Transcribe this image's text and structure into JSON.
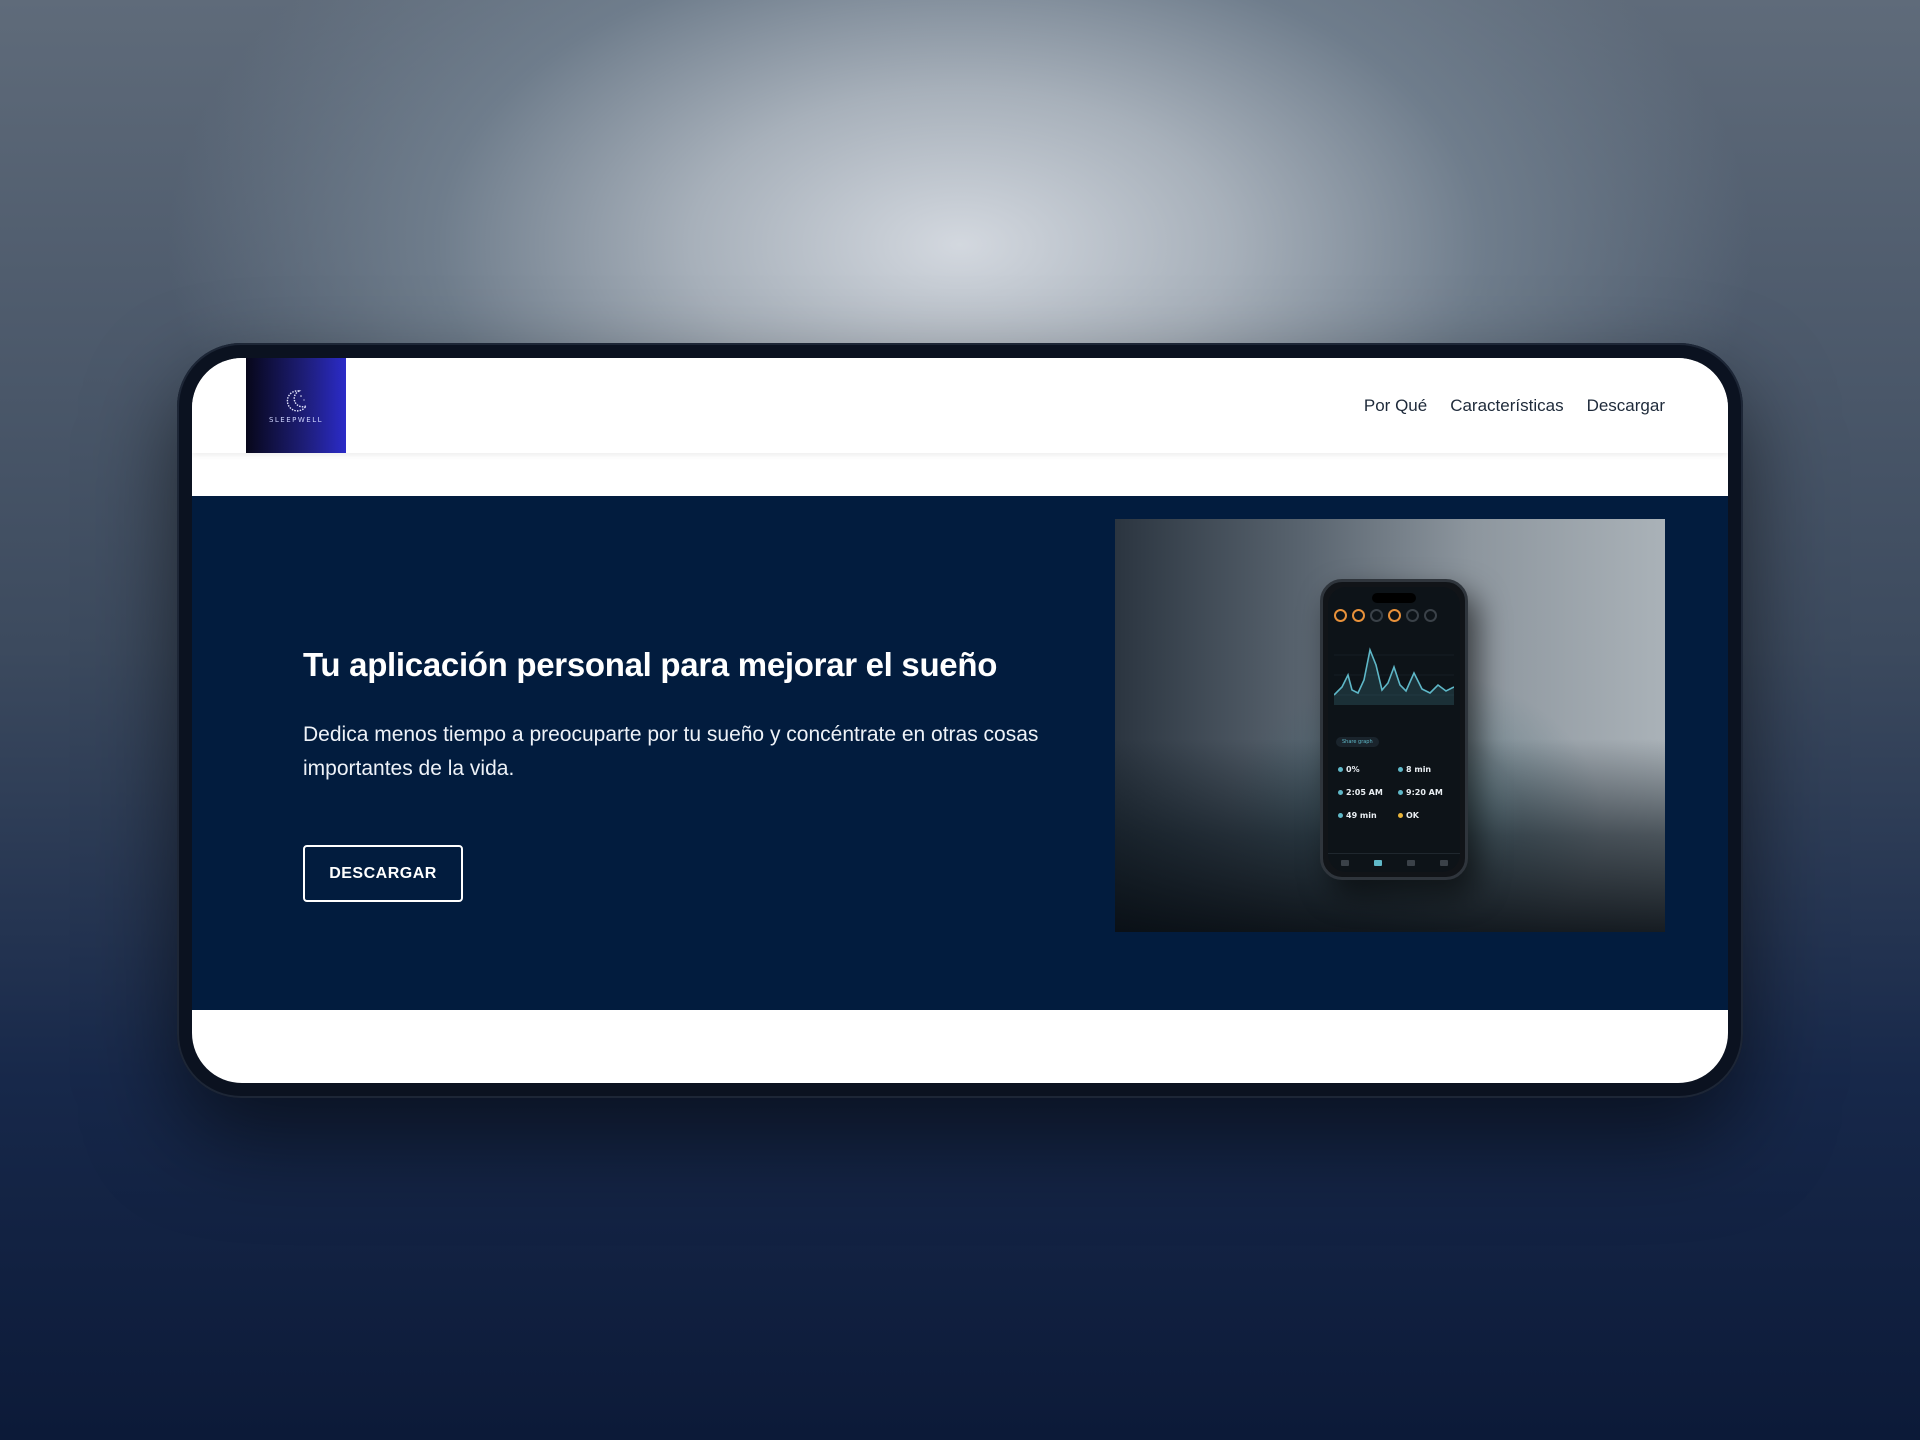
{
  "header": {
    "logo_text": "SLEEPWELL",
    "nav": [
      {
        "label": "Por Qué"
      },
      {
        "label": "Características"
      },
      {
        "label": "Descargar"
      }
    ]
  },
  "hero": {
    "title": "Tu aplicación personal para mejorar el sueño",
    "subtitle": "Dedica menos tiempo a preocuparte por tu sueño y concéntrate en otras cosas importantes de la vida.",
    "cta_label": "DESCARGAR"
  },
  "phone_screen": {
    "share_label": "Share graph",
    "stats": [
      "0%",
      "8 min",
      "2:05 AM",
      "9:20 AM",
      "49 min",
      "OK"
    ]
  },
  "colors": {
    "hero_bg": "#021c3e",
    "logo_accent": "#2b2bc8",
    "graph_line": "#5fb8c8",
    "ring_active": "#e8913a"
  },
  "icons": {
    "logo_mark": "crescent-moon-icon"
  }
}
